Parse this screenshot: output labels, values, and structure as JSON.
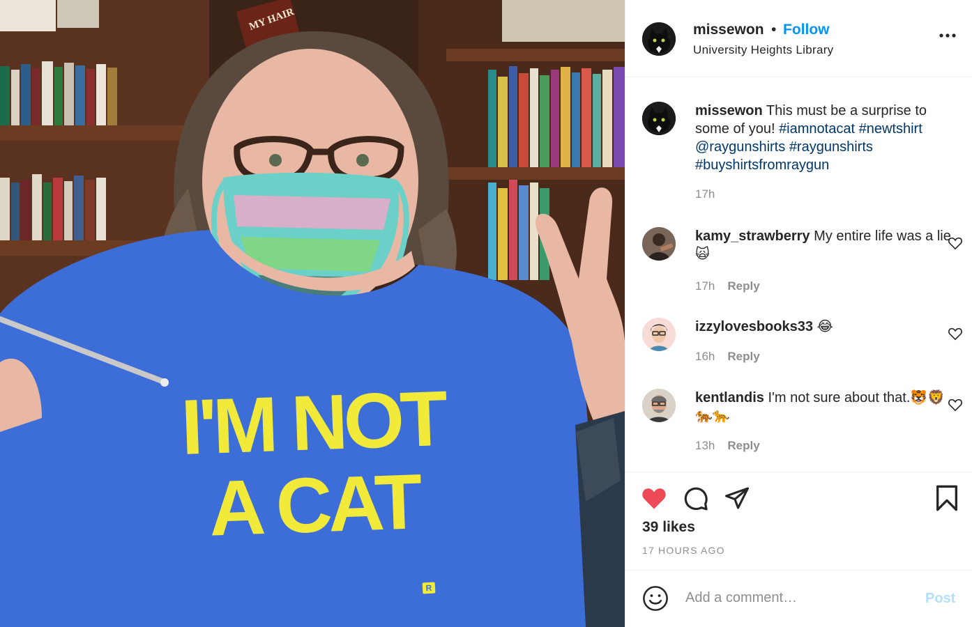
{
  "post": {
    "username": "missewon",
    "follow_label": "Follow",
    "separator": "•",
    "location": "University Heights Library",
    "more_icon": "more-horizontal-icon"
  },
  "photo": {
    "shirt_line1": "I'M NOT",
    "shirt_line2": "A CAT",
    "shirt_badge": "R",
    "sign_text": "MY HAIR",
    "shirt_color": "#3d6ed8",
    "shirt_text_color": "#f2ea3a"
  },
  "comments": [
    {
      "username": "missewon",
      "text_before": "This must be a surprise to some of you! ",
      "tags": [
        "#iamnotacat",
        "#newtshirt",
        "@raygunshirts",
        "#raygunshirts",
        "#buyshirtsfromraygun"
      ],
      "time": "17h"
    },
    {
      "username": "kamy_strawberry",
      "text": "My entire life was a lie🙀",
      "time": "17h",
      "reply_label": "Reply"
    },
    {
      "username": "izzylovesbooks33",
      "text": "😂",
      "time": "16h",
      "reply_label": "Reply"
    },
    {
      "username": "kentlandis",
      "text": "I'm not sure about that.🐯🦁🐅🐆",
      "time": "13h",
      "reply_label": "Reply"
    }
  ],
  "actions": {
    "like_icon": "heart-filled-icon",
    "comment_icon": "comment-icon",
    "share_icon": "share-icon",
    "save_icon": "bookmark-icon",
    "like_color": "#ed4956",
    "likes_text": "39 likes",
    "timeago": "17 HOURS AGO"
  },
  "add_comment": {
    "placeholder": "Add a comment…",
    "post_label": "Post",
    "post_color": "#b2dffc"
  }
}
